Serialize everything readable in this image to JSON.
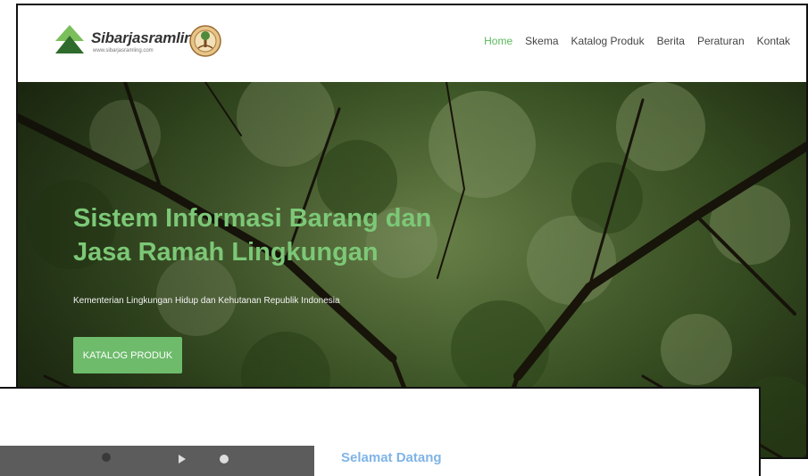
{
  "brand": {
    "name": "Sibarjasramling",
    "url": "www.sibarjasramling.com"
  },
  "nav": {
    "items": [
      "Home",
      "Skema",
      "Katalog Produk",
      "Berita",
      "Peraturan",
      "Kontak"
    ],
    "active": "Home"
  },
  "hero": {
    "title": "Sistem Informasi Barang dan Jasa Ramah Lingkungan",
    "subtitle": "Kementerian Lingkungan Hidup dan Kehutanan Republik Indonesia",
    "button_label": "KATALOG PRODUK"
  },
  "section": {
    "welcome_heading": "Selamat Datang"
  },
  "colors": {
    "accent_green": "#6dbb6b",
    "title_green": "#7cc877",
    "welcome_blue": "#7fb4e6"
  }
}
